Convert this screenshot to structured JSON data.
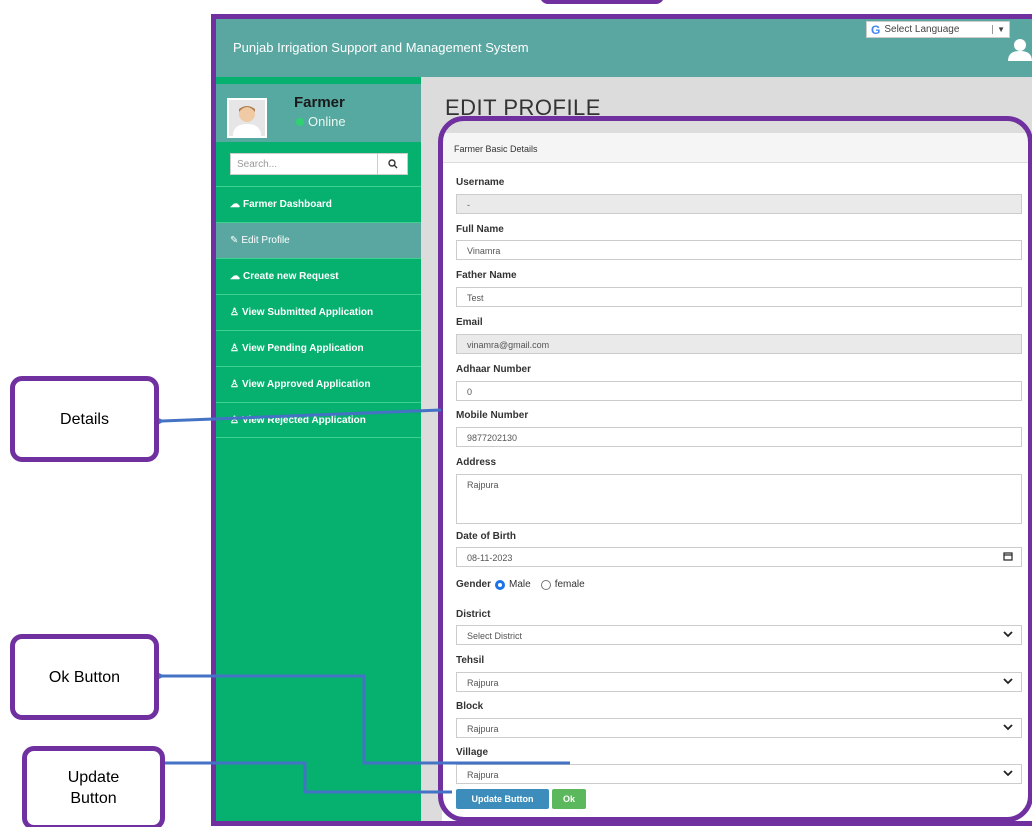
{
  "app": {
    "title": "Punjab Irrigation Support and Management System",
    "language_label": "Select Language",
    "language_arrow": "▼",
    "g_logo": "G"
  },
  "sidebar": {
    "user_name": "Farmer",
    "user_status": "Online",
    "search_placeholder": "Search...",
    "search_icon": "🔍",
    "items": [
      {
        "label": "Farmer Dashboard",
        "icon": "☁"
      },
      {
        "label": "Edit Profile",
        "icon": "✎"
      },
      {
        "label": "Create new Request",
        "icon": "☁"
      },
      {
        "label": "View Submitted Application",
        "icon": "♙"
      },
      {
        "label": "View Pending Application",
        "icon": "♙"
      },
      {
        "label": "View Approved Application",
        "icon": "♙"
      },
      {
        "label": "View Rejected Application",
        "icon": "♙"
      }
    ]
  },
  "page": {
    "title": "EDIT PROFILE",
    "card_title": "Farmer Basic Details"
  },
  "form": {
    "username_label": "Username",
    "username_value": "-",
    "fullname_label": "Full Name",
    "fullname_value": "Vinamra",
    "father_label": "Father Name",
    "father_value": "Test",
    "email_label": "Email",
    "email_value": "vinamra@gmail.com",
    "adhaar_label": "Adhaar Number",
    "adhaar_value": "0",
    "mobile_label": "Mobile Number",
    "mobile_value": "9877202130",
    "address_label": "Address",
    "address_value": "Rajpura",
    "dob_label": "Date of Birth",
    "dob_value": "08-11-2023",
    "gender_label": "Gender",
    "gender_male": "Male",
    "gender_female": "female",
    "district_label": "District",
    "district_value": "Select District",
    "tehsil_label": "Tehsil",
    "tehsil_value": "Rajpura",
    "block_label": "Block",
    "block_value": "Rajpura",
    "village_label": "Village",
    "village_value": "Rajpura",
    "update_label": "Update Button",
    "ok_label": "Ok"
  },
  "callouts": {
    "details": "Details",
    "ok": "Ok Button",
    "update_line1": "Update",
    "update_line2": "Button"
  },
  "colors": {
    "accent_purple": "#7030a0",
    "header_teal": "#5aa7a2",
    "sidebar_green": "#06b06e",
    "arrow_blue": "#4472c4"
  }
}
